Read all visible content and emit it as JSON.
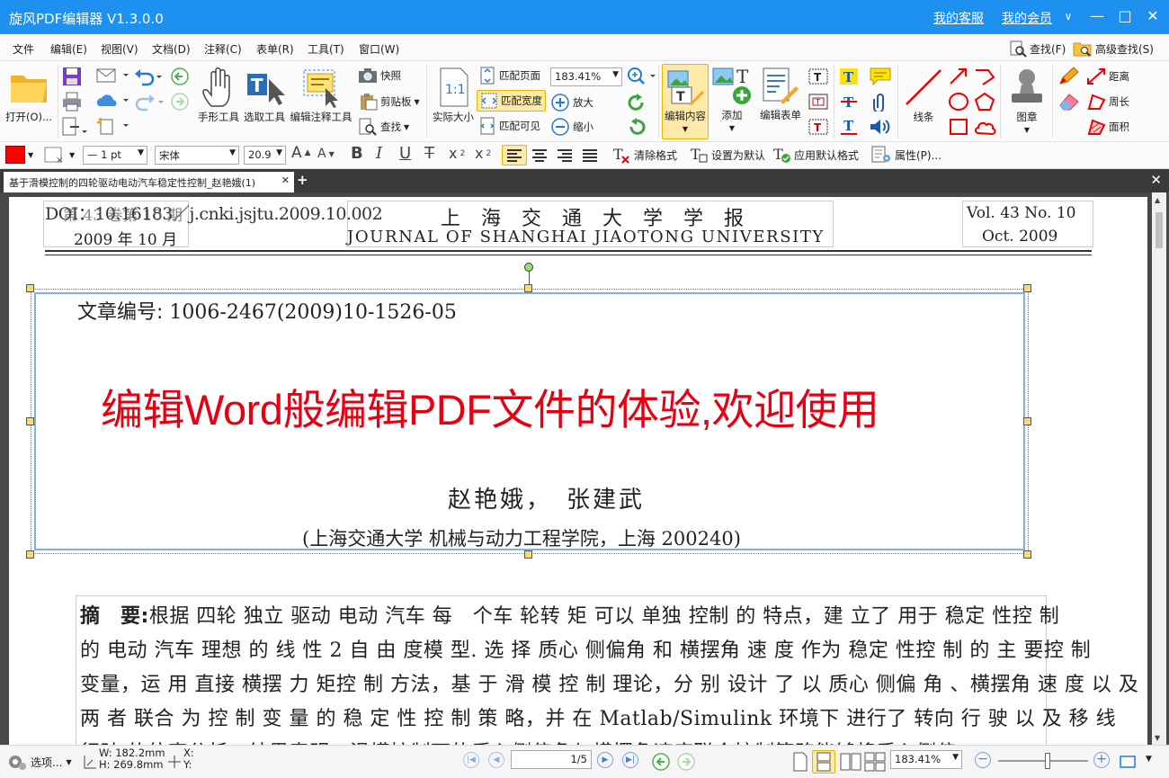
{
  "titlebar": {
    "app_title": "旋风PDF编辑器 V1.3.0.0",
    "service_link": "我的客服",
    "member_link": "我的会员",
    "member_arrow": "∨",
    "minimize": "—",
    "maximize": "□",
    "close": "✕",
    "bg_color": "#1e90f0"
  },
  "menubar": {
    "items": [
      "文件",
      "编辑(E)",
      "视图(V)",
      "文档(D)",
      "注释(C)",
      "表单(R)",
      "工具(T)",
      "窗口(W)"
    ],
    "search": "查找(F)",
    "advanced_search": "高级查找(S)"
  },
  "ribbon": {
    "open": "打开(O)...",
    "hand_tool": "手形工具",
    "select_tool": "选取工具",
    "edit_annot_tool": "编辑注释工具",
    "snapshot": "快照",
    "clipboard": "剪贴板",
    "find": "查找",
    "actual_size": "实际大小",
    "fit_page": "匹配页面",
    "fit_width": "匹配宽度",
    "fit_visible": "匹配可见",
    "zoom_value": "183.41%",
    "zoom_in": "放大",
    "zoom_out": "缩小",
    "edit_content": "编辑内容",
    "add": "添加",
    "edit_form": "编辑表单",
    "lines": "线条",
    "stamp": "图章",
    "distance": "距离",
    "perimeter": "周长",
    "area": "面积"
  },
  "format": {
    "color": "#ff0000",
    "line_width": "1 pt",
    "font": "宋体",
    "font_size": "20.9",
    "clear_format": "清除格式",
    "set_default": "设置为默认",
    "apply_default": "应用默认格式",
    "properties": "属性(P)..."
  },
  "tab": {
    "title": "基于滑模控制的四轮驱动电动汽车稳定性控制_赵艳娥(1)"
  },
  "document": {
    "doi": "DOI：10.16183／j.cnki.jsjtu.2009.10.002",
    "volume_cn": "第 43 卷第 10 期",
    "date_cn": "2009 年 10 月",
    "journal_cn": "上 海 交 通 大 学 学 报",
    "journal_en": "JOURNAL OF SHANGHAI JIAOTONG UNIVERSITY",
    "vol_en": "Vol. 43 No. 10",
    "date_en": "Oct. 2009",
    "article_no_label": "文章编号:",
    "article_no": "1006-2467(2009)10-1526-05",
    "headline": "编辑Word般编辑PDF文件的体验,欢迎使用",
    "headline_color": "#e60012",
    "authors": "赵艳娥，　张建武",
    "affiliation": "(上海交通大学 机械与动力工程学院，上海 200240)",
    "abstract_label": "摘　要:",
    "abstract_lines": [
      "根据 四轮 独立 驱动 电动 汽车 每　个车 轮转 矩 可以 单独 控制 的 特点，建 立了 用于 稳定 性控 制",
      "的 电动 汽车 理想 的 线 性 2 自 由 度模 型. 选 择 质心 侧偏角 和 横摆角 速 度 作为 稳定 性控 制 的 主 要控 制",
      "变量，运 用 直接 横摆 力 矩控 制 方法，基 于 滑 模 控 制 理论，分 别 设计 了 以 质心 侧偏 角 、横摆角 速 度 以 及",
      "两 者 联合 为 控 制 变 量 的 稳 定 性 控 制 策 略，并 在 Matlab/Simulink 环境下 进行了 转向 行 驶 以 及 移 线",
      "行驶 的仿真分析，结果表明，滑模控制下的质心侧偏角与横摆角速度联合控制策略能够将质心侧偏"
    ]
  },
  "status": {
    "options": "选项...",
    "width": "W: 182.2mm",
    "height": "H: 269.8mm",
    "x": "X:",
    "y": "Y:",
    "page_display": "1/5",
    "zoom": "183.41%"
  }
}
